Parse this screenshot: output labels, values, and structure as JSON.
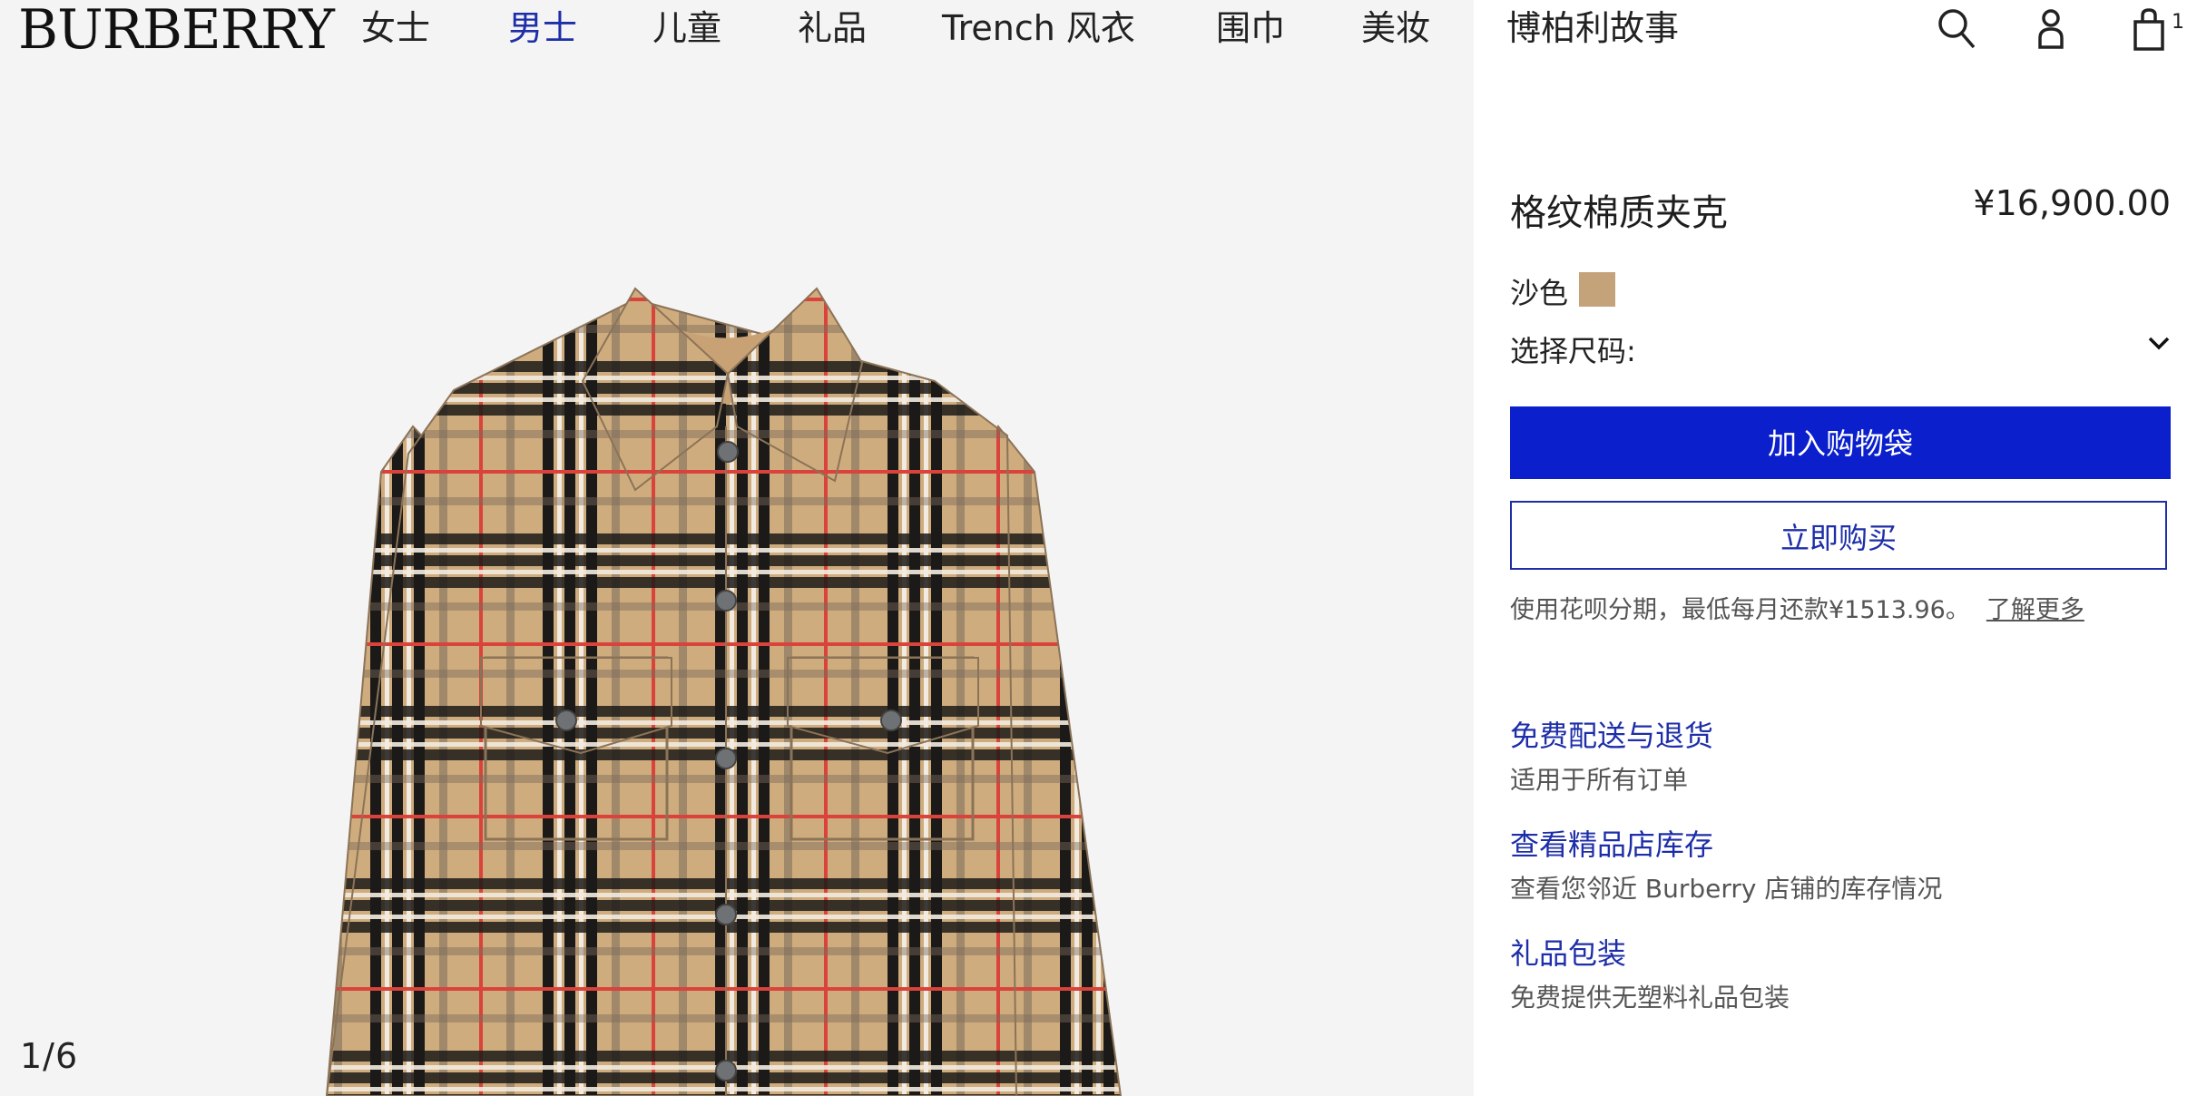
{
  "header": {
    "logo": "BURBERRY",
    "nav": [
      {
        "label": "女士",
        "active": false
      },
      {
        "label": "男士",
        "active": true
      },
      {
        "label": "儿童",
        "active": false
      },
      {
        "label": "礼品",
        "active": false
      },
      {
        "label": "Trench 风衣",
        "active": false
      },
      {
        "label": "围巾",
        "active": false
      },
      {
        "label": "美妆",
        "active": false
      },
      {
        "label": "博柏利故事",
        "active": false
      }
    ],
    "icons": [
      "search-icon",
      "account-icon",
      "shopping-bag-icon"
    ],
    "cart_count": "1"
  },
  "gallery": {
    "counter": "1/6"
  },
  "product": {
    "title": "格纹棉质夹克",
    "price": "¥16,900.00",
    "color_name": "沙色",
    "swatch_color": "#c4a27a",
    "size_label": "选择尺码:",
    "add_to_bag": "加入购物袋",
    "buy_now": "立即购买",
    "installment_text": "使用花呗分期，最低每月还款¥1513.96。",
    "learn_more": "了解更多"
  },
  "services": [
    {
      "title": "免费配送与退货",
      "desc": "适用于所有订单"
    },
    {
      "title": "查看精品店库存",
      "desc": "查看您邻近 Burberry 店铺的库存情况"
    },
    {
      "title": "礼品包装",
      "desc": "免费提供无塑料礼品包装"
    }
  ],
  "colors": {
    "brand_blue": "#0b20cc",
    "link_blue": "#1d2ea8",
    "gallery_bg": "#f4f4f4"
  }
}
